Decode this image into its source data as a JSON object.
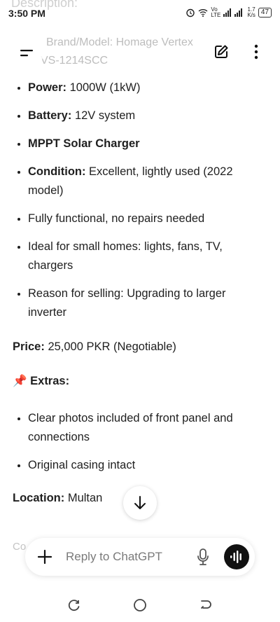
{
  "status_bar": {
    "time": "3:50 PM",
    "network_label": "Vo LTE",
    "speed_top": "1.7",
    "speed_bottom": "K/s",
    "battery": "47"
  },
  "header": {
    "faded_heading": "Description:",
    "faded_brand_line": "Brand/Model: Homage Vertex",
    "faded_model_line": "VS-1214SCC",
    "menu_icon": "hamburger-icon",
    "edit_icon": "new-chat-icon",
    "more_icon": "more-vertical-icon"
  },
  "listing": {
    "items": [
      {
        "label": "Power:",
        "text": " 1000W (1kW)"
      },
      {
        "label": "Battery:",
        "text": " 12V system"
      },
      {
        "label": "MPPT Solar Charger",
        "text": ""
      },
      {
        "label": "Condition:",
        "text": " Excellent, lightly used (2022 model)"
      },
      {
        "label": "",
        "text": "Fully functional, no repairs needed"
      },
      {
        "label": "",
        "text": "Ideal for small homes: lights, fans, TV, chargers"
      },
      {
        "label": "",
        "text": "Reason for selling: Upgrading to larger inverter"
      }
    ],
    "price_label": "Price:",
    "price_value": " 25,000 PKR (Negotiable)",
    "extras_emoji": "📌",
    "extras_label": " Extras:",
    "extras": [
      "Clear photos included of front panel and connections",
      "Original casing intact"
    ],
    "location_label": "Location:",
    "location_value": " Multan",
    "faded_next": "Co"
  },
  "composer": {
    "placeholder": "Reply to ChatGPT"
  }
}
